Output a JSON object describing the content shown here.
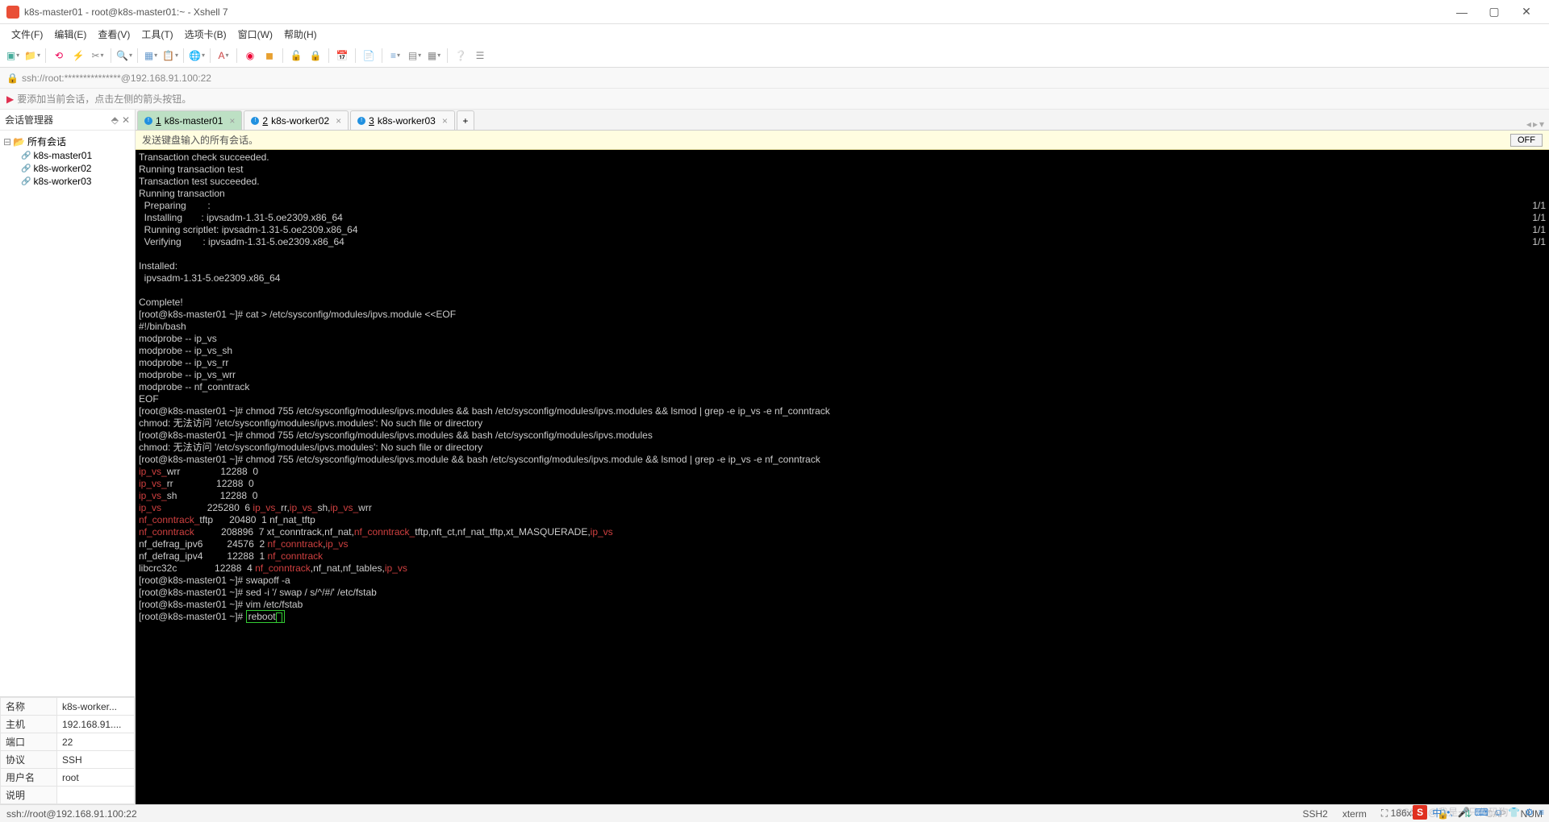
{
  "window": {
    "title": "k8s-master01 - root@k8s-master01:~ - Xshell 7",
    "min": "—",
    "max": "▢",
    "close": "✕"
  },
  "menu": [
    "文件(F)",
    "编辑(E)",
    "查看(V)",
    "工具(T)",
    "选项卡(B)",
    "窗口(W)",
    "帮助(H)"
  ],
  "address": "ssh://root:***************@192.168.91.100:22",
  "hint": "要添加当前会话，点击左侧的箭头按钮。",
  "sidebar": {
    "title": "会话管理器",
    "root": "所有会话",
    "items": [
      "k8s-master01",
      "k8s-worker02",
      "k8s-worker03"
    ]
  },
  "props": {
    "rows": [
      [
        "名称",
        "k8s-worker..."
      ],
      [
        "主机",
        "192.168.91...."
      ],
      [
        "端口",
        "22"
      ],
      [
        "协议",
        "SSH"
      ],
      [
        "用户名",
        "root"
      ],
      [
        "说明",
        ""
      ]
    ]
  },
  "tabs": [
    {
      "num": "1",
      "label": "k8s-master01",
      "active": true
    },
    {
      "num": "2",
      "label": "k8s-worker02",
      "active": false
    },
    {
      "num": "3",
      "label": "k8s-worker03",
      "active": false
    }
  ],
  "yellow": {
    "text": "发送键盘输入的所有会话。",
    "off": "OFF"
  },
  "status": {
    "left": "ssh://root@192.168.91.100:22",
    "ssh": "SSH2",
    "term": "xterm",
    "size": "186x39",
    "sizeIcon": "⛶",
    "sec": "🔒",
    "net": "⇅",
    "cap": "CAP",
    "num": "NUM"
  },
  "watermark": "CSDN @我是一只代码狗",
  "term": {
    "l01": "Transaction check succeeded.",
    "l02": "Running transaction test",
    "l03": "Transaction test succeeded.",
    "l04": "Running transaction",
    "l05": "  Preparing        :                                                                                                                                                                                 ",
    "l05r": "1/1",
    "l06": "  Installing       : ipvsadm-1.31-5.oe2309.x86_64                                                                                                                                                    ",
    "l06r": "1/1",
    "l07": "  Running scriptlet: ipvsadm-1.31-5.oe2309.x86_64                                                                                                                                                    ",
    "l07r": "1/1",
    "l08": "  Verifying        : ipvsadm-1.31-5.oe2309.x86_64                                                                                                                                                    ",
    "l08r": "1/1",
    "l10": "Installed:",
    "l11": "  ipvsadm-1.31-5.oe2309.x86_64",
    "l13": "Complete!",
    "l14": "[root@k8s-master01 ~]# cat > /etc/sysconfig/modules/ipvs.module <<EOF",
    "l15": "#!/bin/bash",
    "l16": "modprobe -- ip_vs",
    "l17": "modprobe -- ip_vs_sh",
    "l18": "modprobe -- ip_vs_rr",
    "l19": "modprobe -- ip_vs_wrr",
    "l20": "modprobe -- nf_conntrack",
    "l21": "EOF",
    "l22": "[root@k8s-master01 ~]# chmod 755 /etc/sysconfig/modules/ipvs.modules && bash /etc/sysconfig/modules/ipvs.modules && lsmod | grep -e ip_vs -e nf_conntrack",
    "l23": "chmod: 无法访问 '/etc/sysconfig/modules/ipvs.modules': No such file or directory",
    "l24": "[root@k8s-master01 ~]# chmod 755 /etc/sysconfig/modules/ipvs.modules && bash /etc/sysconfig/modules/ipvs.modules",
    "l25": "chmod: 无法访问 '/etc/sysconfig/modules/ipvs.modules': No such file or directory",
    "l26": "[root@k8s-master01 ~]# chmod 755 /etc/sysconfig/modules/ipvs.module && bash /etc/sysconfig/modules/ipvs.module && lsmod | grep -e ip_vs -e nf_conntrack",
    "m1a": "ip_vs_",
    "m1b": "wrr               12288  0",
    "m2a": "ip_vs_",
    "m2b": "rr                12288  0",
    "m3a": "ip_vs_",
    "m3b": "sh                12288  0",
    "m4a": "ip_vs",
    "m4b": "                 225280  6 ",
    "m4c": "ip_vs_",
    "m4d": "rr,",
    "m4e": "ip_vs_",
    "m4f": "sh,",
    "m4g": "ip_vs_",
    "m4h": "wrr",
    "m5a": "nf_conntrack_",
    "m5b": "tftp      20480  1 nf_nat_tftp",
    "m6a": "nf_conntrack",
    "m6b": "          208896  7 xt_conntrack,nf_nat,",
    "m6c": "nf_conntrack_",
    "m6d": "tftp,nft_ct,nf_nat_tftp,xt_MASQUERADE,",
    "m6e": "ip_vs",
    "m7a": "nf_defrag_ipv6         24576  2 ",
    "m7b": "nf_conntrack",
    "m7c": ",",
    "m7d": "ip_vs",
    "m8a": "nf_defrag_ipv4         12288  1 ",
    "m8b": "nf_conntrack",
    "m9a": "libcrc32c              12288  4 ",
    "m9b": "nf_conntrack",
    "m9c": ",nf_nat,nf_tables,",
    "m9d": "ip_vs",
    "p1": "[root@k8s-master01 ~]# swapoff -a",
    "p2": "[root@k8s-master01 ~]# sed -i '/ swap / s/^/#/' /etc/fstab",
    "p3": "[root@k8s-master01 ~]# vim /etc/fstab",
    "p4a": "[root@k8s-master01 ~]# ",
    "p4b": "reboot"
  }
}
